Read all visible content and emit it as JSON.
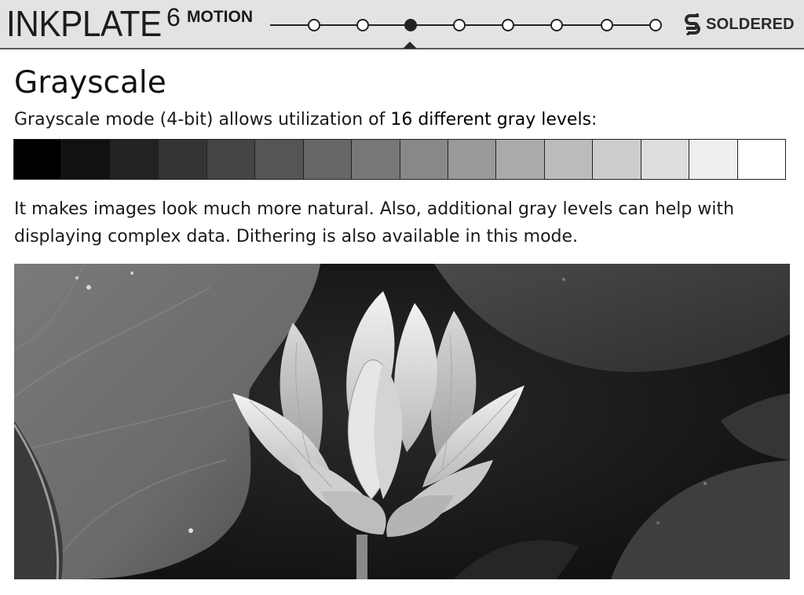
{
  "header": {
    "logo_main": "INKPLATE",
    "logo_number": "6",
    "logo_suffix": "MOTION",
    "stepper": {
      "steps": 8,
      "active_index": 2
    },
    "brand": "SOLDERED"
  },
  "main": {
    "title": "Grayscale",
    "intro_before": "Grayscale mode (4-bit) allows utilization of ",
    "intro_strong": "16 different gray levels",
    "intro_after": ":",
    "body_line1": "It makes images look much more natural. Also, additional gray levels can help with",
    "body_line2": "displaying complex data. Dithering is also available in this mode.",
    "gray_levels": [
      "#000000",
      "#111111",
      "#222222",
      "#333333",
      "#444444",
      "#555555",
      "#666666",
      "#777777",
      "#888888",
      "#999999",
      "#aaaaaa",
      "#bbbbbb",
      "#cccccc",
      "#dddddd",
      "#eeeeee",
      "#ffffff"
    ]
  },
  "colors": {
    "header_bg": "#e3e3e3",
    "text": "#111111",
    "accent": "#222222"
  }
}
